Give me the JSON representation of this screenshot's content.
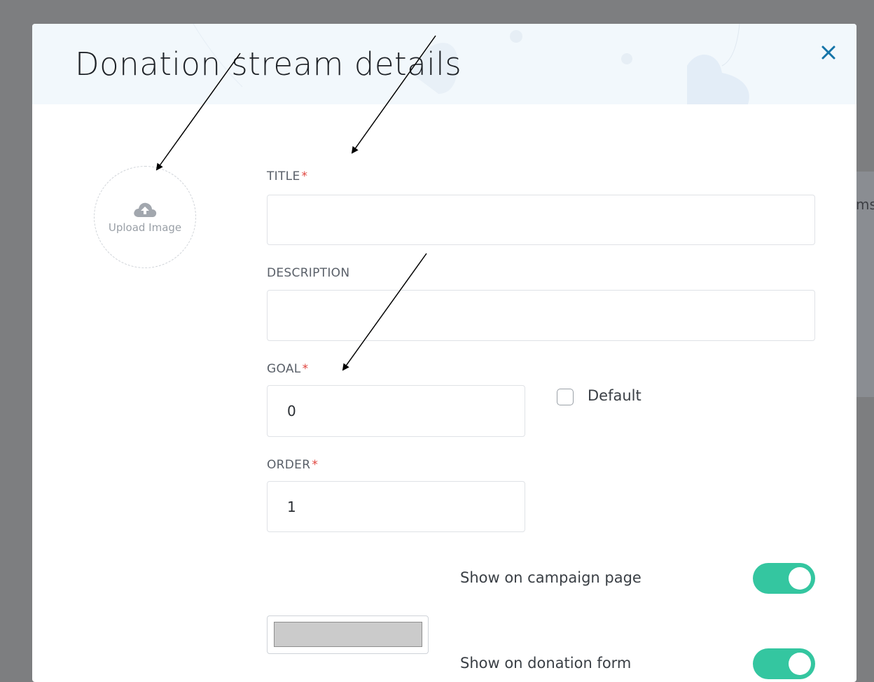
{
  "background": {
    "partial_text": "ms"
  },
  "modal": {
    "title": "Donation stream details",
    "close_glyph": "✕"
  },
  "upload": {
    "label": "Upload Image",
    "icon": "cloud-upload-icon"
  },
  "fields": {
    "title": {
      "label": "TITLE",
      "required": "*",
      "value": ""
    },
    "description": {
      "label": "DESCRIPTION",
      "value": ""
    },
    "goal": {
      "label": "GOAL",
      "required": "*",
      "value": "0"
    },
    "order": {
      "label": "ORDER",
      "required": "*",
      "value": "1"
    }
  },
  "default_checkbox": {
    "label": "Default",
    "checked": false
  },
  "toggles": {
    "campaign_page": {
      "label": "Show on campaign page",
      "on": true
    },
    "donation_form": {
      "label": "Show on donation form",
      "on": true
    }
  },
  "colors": {
    "toggle_on": "#34c6a0",
    "accent": "#1474a8",
    "required": "#e0453f",
    "header_bg": "#f2f8fc",
    "swatch": "#cbcbcb"
  }
}
